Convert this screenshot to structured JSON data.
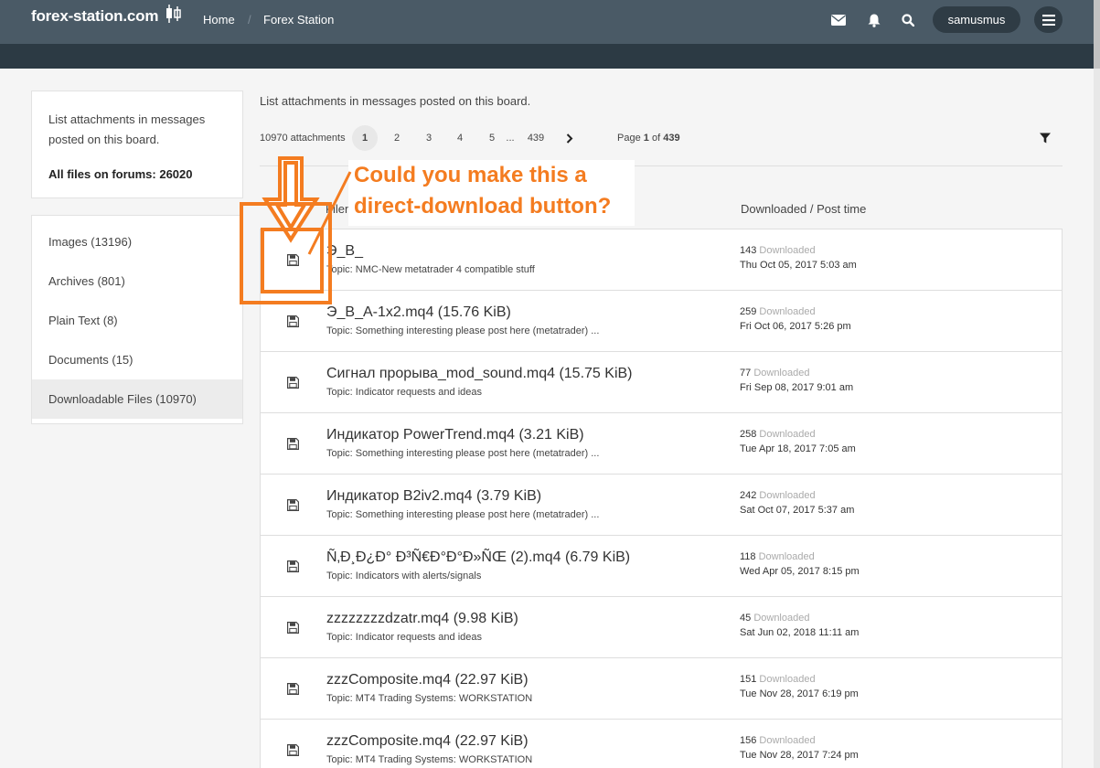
{
  "header": {
    "logo": "forex-station.com",
    "breadcrumbs": [
      {
        "label": "Home"
      },
      {
        "label": "Forex Station"
      }
    ],
    "username": "samusmus",
    "colors": {
      "nav": "#4a5a66",
      "subnav": "#2c3a44",
      "accent": "#f47c20"
    }
  },
  "sidebar": {
    "description": "List attachments in messages posted on this board.",
    "total_label": "All files on forums: 26020",
    "items": [
      {
        "label": "Images (13196)"
      },
      {
        "label": "Archives (801)"
      },
      {
        "label": "Plain Text (8)"
      },
      {
        "label": "Documents (15)"
      },
      {
        "label": "Downloadable Files (10970)"
      }
    ]
  },
  "main": {
    "description": "List attachments in messages posted on this board.",
    "pagination": {
      "count": "10970 attachments",
      "pages": [
        "1",
        "2",
        "3",
        "4",
        "5"
      ],
      "ellipsis": "...",
      "last": "439",
      "current": "1",
      "page_of_prefix": "Page",
      "page_of_current": "1",
      "page_of_sep": "of",
      "page_of_total": "439"
    },
    "columns": {
      "filename": "Filena",
      "downloaded": "Downloaded / Post time"
    },
    "downloaded_word": "Downloaded",
    "rows": [
      {
        "name": "Э_B_",
        "topic": "Topic: NMC-New metatrader 4 compatible stuff",
        "count": "143",
        "time": "Thu Oct 05, 2017 5:03 am"
      },
      {
        "name": "Э_B_A-1x2.mq4 (15.76 KiB)",
        "topic": "Topic: Something interesting please post here (metatrader) ...",
        "count": "259",
        "time": "Fri Oct 06, 2017 5:26 pm"
      },
      {
        "name": "Сигнал прорыва_mod_sound.mq4 (15.75 KiB)",
        "topic": "Topic: Indicator requests and ideas",
        "count": "77",
        "time": "Fri Sep 08, 2017 9:01 am"
      },
      {
        "name": "Индикатор PowerTrend.mq4 (3.21 KiB)",
        "topic": "Topic: Something interesting please post here (metatrader) ...",
        "count": "258",
        "time": "Tue Apr 18, 2017 7:05 am"
      },
      {
        "name": "Индикатор B2iv2.mq4 (3.79 KiB)",
        "topic": "Topic: Something interesting please post here (metatrader) ...",
        "count": "242",
        "time": "Sat Oct 07, 2017 5:37 am"
      },
      {
        "name": "Ñ‚Ð¸Ð¿Ð° Ð³Ñ€Ð°Ð°Ð»ÑŒ (2).mq4 (6.79 KiB)",
        "topic": "Topic: Indicators with alerts/signals",
        "count": "118",
        "time": "Wed Apr 05, 2017 8:15 pm"
      },
      {
        "name": "zzzzzzzzdzatr.mq4 (9.98 KiB)",
        "topic": "Topic: Indicator requests and ideas",
        "count": "45",
        "time": "Sat Jun 02, 2018 11:11 am"
      },
      {
        "name": "zzzComposite.mq4 (22.97 KiB)",
        "topic": "Topic: MT4 Trading Systems: WORKSTATION",
        "count": "151",
        "time": "Tue Nov 28, 2017 6:19 pm"
      },
      {
        "name": "zzzComposite.mq4 (22.97 KiB)",
        "topic": "Topic: MT4 Trading Systems: WORKSTATION",
        "count": "156",
        "time": "Tue Nov 28, 2017 7:24 pm"
      }
    ]
  },
  "annotation": {
    "line1": "Could you make this a",
    "line2": "direct-download button?"
  }
}
